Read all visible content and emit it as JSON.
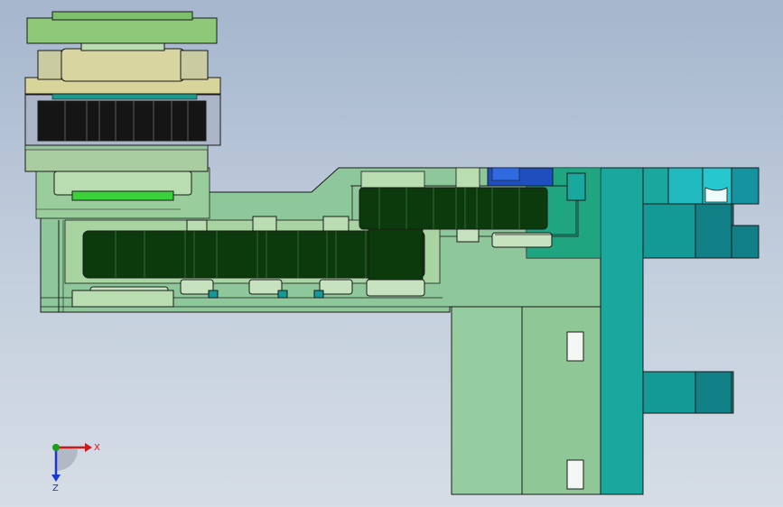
{
  "viewport": {
    "background_top": "#a5b6cd",
    "background_bottom": "#d6dde6"
  },
  "colors": {
    "housing_green": "#8ec79a",
    "pale_green": "#a8d4a2",
    "light_green_fill": "#b9dcb0",
    "belt_dark_green": "#0d3a0d",
    "teal": "#1aa79e",
    "dark_teal": "#0f8a86",
    "cyan": "#27c7cf",
    "blue": "#1f4fbf",
    "beige": "#d9d49a",
    "edge": "#1a1a1a"
  },
  "triad": {
    "x_label": "X",
    "z_label": "Z",
    "x_color": "#d01818",
    "y_color": "#18a018",
    "z_color": "#1838d0"
  }
}
